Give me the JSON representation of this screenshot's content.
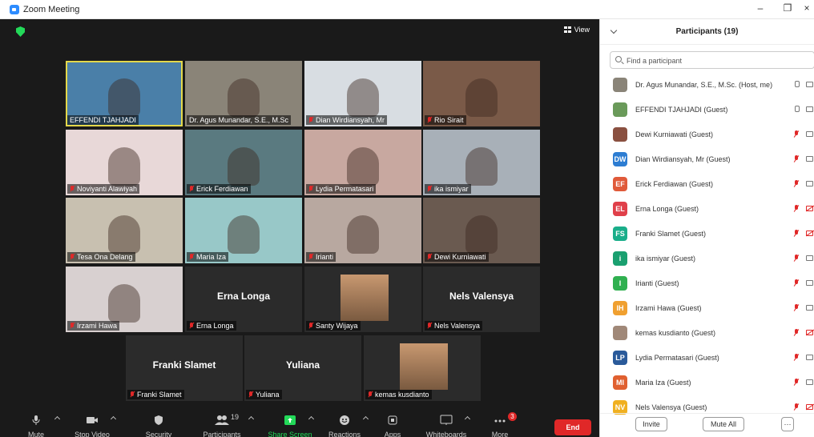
{
  "window": {
    "title": "Zoom Meeting",
    "minimize": "–",
    "restore": "❐",
    "close": "×"
  },
  "view": {
    "label": "View"
  },
  "tiles": [
    {
      "name": "EFFENDI TJAHJADI",
      "muted": false,
      "color": "#4a7fa8",
      "active": true
    },
    {
      "name": "Dr. Agus Munandar, S.E., M.Sc",
      "muted": false,
      "color": "#8a8478"
    },
    {
      "name": "Dian Wirdiansyah, Mr",
      "muted": true,
      "color": "#d8dde2"
    },
    {
      "name": "Rio Sirait",
      "muted": true,
      "color": "#7a5a48"
    },
    {
      "name": "Noviyanti Alawiyah",
      "muted": true,
      "color": "#e8d8d8"
    },
    {
      "name": "Erick Ferdiawan",
      "muted": true,
      "color": "#5a7a80"
    },
    {
      "name": "Lydia Permatasari",
      "muted": true,
      "color": "#c8a8a0"
    },
    {
      "name": "ika ismiyar",
      "muted": true,
      "color": "#a8b0b8"
    },
    {
      "name": "Tesa Ona Delang",
      "muted": true,
      "color": "#c8c0b0"
    },
    {
      "name": "Maria Iza",
      "muted": true,
      "color": "#98c8c8"
    },
    {
      "name": "Irianti",
      "muted": true,
      "color": "#b8a8a0"
    },
    {
      "name": "Dewi Kurniawati",
      "muted": true,
      "color": "#6a5a50"
    },
    {
      "name": "Irzami Hawa",
      "muted": true,
      "color": "#d8d0d0"
    },
    {
      "name": "Erna Longa",
      "muted": true,
      "center": "Erna Longa"
    },
    {
      "name": "Santy Wijaya",
      "muted": true,
      "avatar": true
    },
    {
      "name": "Nels Valensya",
      "muted": true,
      "center": "Nels Valensya"
    },
    {
      "name": "Franki Slamet",
      "muted": true,
      "center": "Franki Slamet"
    },
    {
      "name": "Yuliana",
      "muted": true,
      "center": "Yuliana"
    },
    {
      "name": "kemas kusdianto",
      "muted": true,
      "avatar": true
    }
  ],
  "toolbar": {
    "mute": "Mute",
    "stop_video": "Stop Video",
    "security": "Security",
    "participants": "Participants",
    "participants_count": "19",
    "share_screen": "Share Screen",
    "reactions": "Reactions",
    "apps": "Apps",
    "whiteboards": "Whiteboards",
    "more": "More",
    "more_badge": "3",
    "end": "End"
  },
  "panel": {
    "title": "Participants (19)",
    "search_placeholder": "Find a participant",
    "invite": "Invite",
    "mute_all": "Mute All",
    "more": "···",
    "participants": [
      {
        "name": "Dr. Agus Munandar, S.E., M.Sc. (Host, me)",
        "initials": "",
        "color": "#8a8478",
        "mic": "on",
        "cam": "on"
      },
      {
        "name": "EFFENDI TJAHJADI (Guest)",
        "initials": "",
        "color": "#6a9a5a",
        "mic": "on",
        "cam": "on"
      },
      {
        "name": "Dewi Kurniawati (Guest)",
        "initials": "",
        "color": "#8a5040",
        "mic": "off",
        "cam": "on"
      },
      {
        "name": "Dian Wirdiansyah, Mr (Guest)",
        "initials": "DW",
        "color": "#2d7dd2",
        "mic": "off",
        "cam": "on"
      },
      {
        "name": "Erick Ferdiawan (Guest)",
        "initials": "EF",
        "color": "#e05a3a",
        "mic": "off",
        "cam": "on"
      },
      {
        "name": "Erna Longa (Guest)",
        "initials": "EL",
        "color": "#e0404a",
        "mic": "off",
        "cam": "off"
      },
      {
        "name": "Franki Slamet (Guest)",
        "initials": "FS",
        "color": "#1aae8a",
        "mic": "off",
        "cam": "off"
      },
      {
        "name": "ika ismiyar (Guest)",
        "initials": "i",
        "color": "#1aa070",
        "mic": "off",
        "cam": "on"
      },
      {
        "name": "Irianti (Guest)",
        "initials": "I",
        "color": "#30b050",
        "mic": "off",
        "cam": "on"
      },
      {
        "name": "Irzami Hawa (Guest)",
        "initials": "IH",
        "color": "#f0a030",
        "mic": "off",
        "cam": "on"
      },
      {
        "name": "kemas kusdianto (Guest)",
        "initials": "",
        "color": "#a08878",
        "mic": "off",
        "cam": "off"
      },
      {
        "name": "Lydia Permatasari (Guest)",
        "initials": "LP",
        "color": "#2a5a9a",
        "mic": "off",
        "cam": "on"
      },
      {
        "name": "Maria Iza (Guest)",
        "initials": "MI",
        "color": "#e06030",
        "mic": "off",
        "cam": "on"
      },
      {
        "name": "Nels Valensya (Guest)",
        "initials": "NV",
        "color": "#f0b020",
        "mic": "off",
        "cam": "off"
      }
    ]
  }
}
